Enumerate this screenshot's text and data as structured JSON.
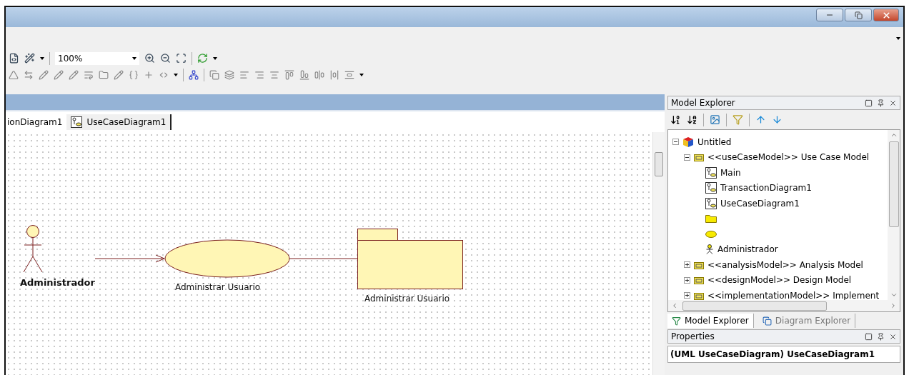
{
  "toolbar": {
    "zoom": "100%"
  },
  "document_tabs": [
    {
      "label": "ionDiagram1",
      "selected": false
    },
    {
      "label": "UseCaseDiagram1",
      "selected": true
    }
  ],
  "diagram": {
    "nodes": [
      {
        "kind": "actor",
        "label": "Administrador"
      },
      {
        "kind": "usecase",
        "label": "Administrar Usuario"
      },
      {
        "kind": "package",
        "label": "Administrar Usuario"
      }
    ],
    "edges": [
      {
        "kind": "arrow"
      },
      {
        "kind": "line"
      }
    ]
  },
  "model_explorer": {
    "title": "Model Explorer",
    "tree": [
      {
        "kind": "project",
        "label": "Untitled",
        "expanded": true,
        "children": [
          {
            "kind": "model",
            "label": "<<useCaseModel>> Use Case Model",
            "expanded": true,
            "children": [
              {
                "kind": "diagram",
                "label": "Main"
              },
              {
                "kind": "diagram",
                "label": "TransactionDiagram1"
              },
              {
                "kind": "diagram",
                "label": "UseCaseDiagram1"
              },
              {
                "kind": "folder"
              },
              {
                "kind": "usecase"
              },
              {
                "kind": "actor",
                "label": "Administrador"
              }
            ]
          },
          {
            "kind": "model",
            "label": "<<analysisModel>> Analysis Model",
            "expanded": false
          },
          {
            "kind": "model",
            "label": "<<designModel>> Design Model",
            "expanded": false
          },
          {
            "kind": "model",
            "label": "<<implementationModel>> Implement",
            "expanded": false
          }
        ]
      }
    ],
    "tabs": [
      {
        "label": "Model Explorer",
        "selected": true
      },
      {
        "label": "Diagram Explorer",
        "selected": false
      }
    ]
  },
  "properties": {
    "title": "Properties",
    "heading": "(UML UseCaseDiagram) UseCaseDiagram1"
  }
}
